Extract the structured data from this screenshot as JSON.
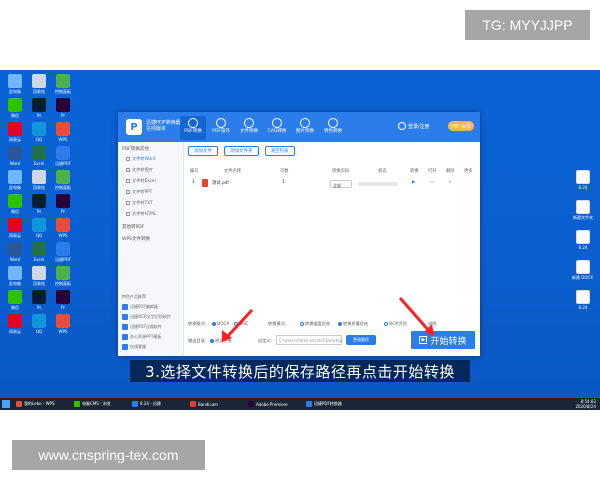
{
  "watermarks": {
    "top": "TG: MYYJJPP",
    "bottom": "www.cnspring-tex.com"
  },
  "subtitle": "3.选择文件转换后的保存路径再点击开始转换",
  "desktop_icons": [
    {
      "label": "此电脑",
      "color": "#6fb7ff"
    },
    {
      "label": "回收站",
      "color": "#cfd8dc"
    },
    {
      "label": "控制面板",
      "color": "#4caf50"
    },
    {
      "label": "微信",
      "color": "#2dc100"
    },
    {
      "label": "Ps",
      "color": "#001e36"
    },
    {
      "label": "Pr",
      "color": "#2a0038"
    },
    {
      "label": "网易云",
      "color": "#e60026"
    },
    {
      "label": "QQ",
      "color": "#1296db"
    },
    {
      "label": "WPS",
      "color": "#e74c3c"
    },
    {
      "label": "Word",
      "color": "#2b579a"
    },
    {
      "label": "Excel",
      "color": "#217346"
    },
    {
      "label": "迅捷PDF",
      "color": "#2b7de9"
    }
  ],
  "right_icons": [
    {
      "label": "8.24"
    },
    {
      "label": "新建文件夹"
    },
    {
      "label": "8.24"
    },
    {
      "label": "新建 DOCX 文档"
    },
    {
      "label": "8.24"
    }
  ],
  "app": {
    "logo": "P",
    "name": "迅捷PDF转换器",
    "version": "在线版本",
    "tabs": [
      {
        "label": "PDF转换",
        "active": true
      },
      {
        "label": "PDF操作",
        "active": false
      },
      {
        "label": "文件转换",
        "active": false
      },
      {
        "label": "CAD转换",
        "active": false
      },
      {
        "label": "图片转换",
        "active": false
      },
      {
        "label": "特色转换",
        "active": false
      }
    ],
    "login": "登录/注册",
    "vip": "VIP 会员",
    "sidebar": {
      "group1": "PDF转换其他",
      "items": [
        {
          "label": "文件转Word",
          "active": true
        },
        {
          "label": "文件转图片",
          "active": false
        },
        {
          "label": "文件转Excel",
          "active": false
        },
        {
          "label": "文件转PPT",
          "active": false
        },
        {
          "label": "文件转TXT",
          "active": false
        },
        {
          "label": "文件转HTML",
          "active": false
        }
      ],
      "group2": "其他转PDF",
      "group3": "WPS文件转换",
      "bottom_title": "特色产品推荐",
      "bottom_items": [
        "迅捷PDF编辑器",
        "迅捷OCR文字识别软件",
        "迅捷PDF压缩软件",
        "办公资源PPT模板",
        "在线客服"
      ]
    },
    "toolbar": {
      "add_file": "添加文件",
      "add_folder": "添加文件夹",
      "clear": "清空列表"
    },
    "table": {
      "headers": [
        "编号",
        "文件名称",
        "页数",
        "转换页码",
        "状态",
        "转换",
        "打开",
        "删除",
        "更多"
      ],
      "rows": [
        {
          "no": "1",
          "name": "测试.pdf",
          "pages": "1",
          "range": "全部",
          "progress": 0
        }
      ]
    },
    "status": {
      "output_format_label": "转换格式：",
      "docx": "DOCX",
      "doc": "DOC",
      "mode_label": "转换模式：",
      "mode_opt1": "转换速度优先",
      "mode_opt2": "转换质量优先",
      "ocr": "OCR识别",
      "more": "说明"
    },
    "path": {
      "label": "输出目录：",
      "radio_original": "原文件夹",
      "custom_label": "自定义：",
      "path_value": "C:\\Users\\Administrator\\Desktop",
      "change_btn": "更改路径"
    },
    "start_button": "开始转换"
  },
  "taskbar": {
    "items": [
      {
        "label": "我的Lebo - WPS",
        "color": "#e74c3c"
      },
      {
        "label": "电脑CMS - 浏览",
        "color": "#2dc100"
      },
      {
        "label": "8.24 - 迅捷",
        "color": "#2b7de9"
      },
      {
        "label": "Bandicam",
        "color": "#e53935"
      },
      {
        "label": "Adobe Premiere",
        "color": "#2a0038"
      },
      {
        "label": "迅捷PDF转换器",
        "color": "#2b7de9"
      }
    ],
    "time": "8:54:02",
    "date": "2020/8/24"
  }
}
